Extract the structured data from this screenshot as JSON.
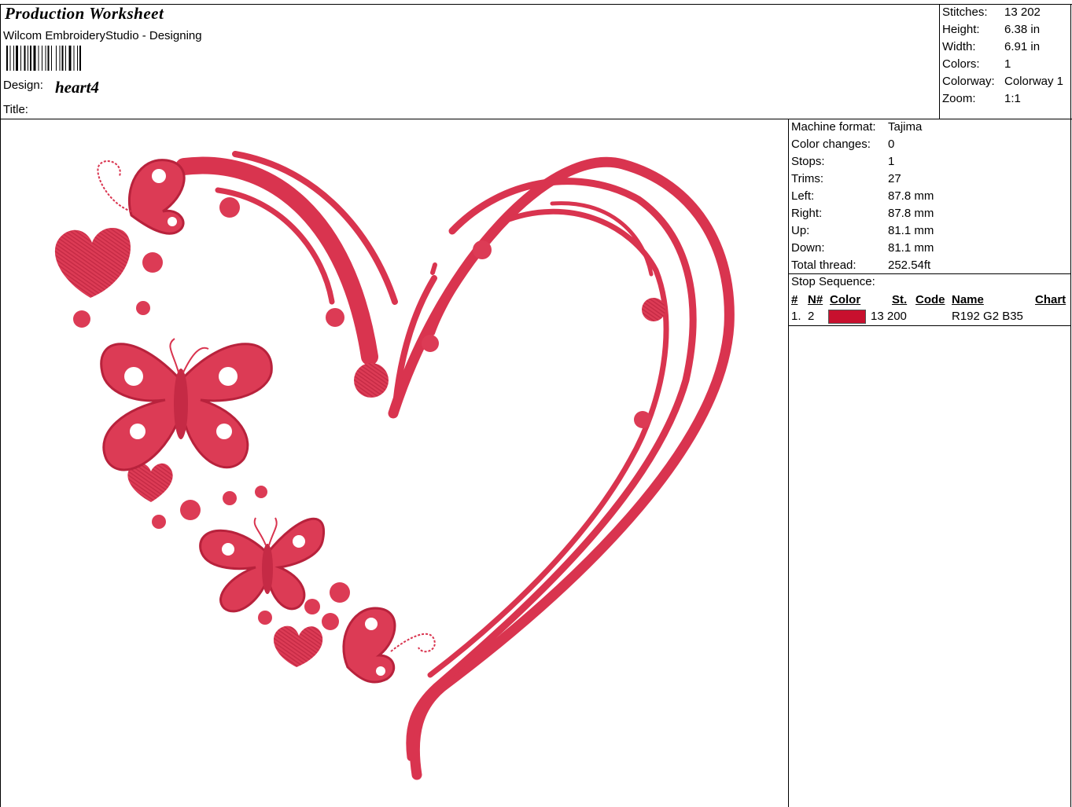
{
  "header": {
    "title": "Production Worksheet",
    "app": "Wilcom EmbroideryStudio - Designing",
    "design_label": "Design:",
    "design_value": "heart4",
    "title_label": "Title:"
  },
  "summary": [
    {
      "label": "Stitches:",
      "value": "13 202"
    },
    {
      "label": "Height:",
      "value": "6.38 in"
    },
    {
      "label": "Width:",
      "value": "6.91 in"
    },
    {
      "label": "Colors:",
      "value": "1"
    },
    {
      "label": "Colorway:",
      "value": "Colorway 1"
    },
    {
      "label": "Zoom:",
      "value": "1:1"
    }
  ],
  "machine_info": [
    {
      "label": "Machine format:",
      "value": "Tajima"
    },
    {
      "label": "Color changes:",
      "value": "0"
    },
    {
      "label": "Stops:",
      "value": "1"
    },
    {
      "label": "Trims:",
      "value": "27"
    },
    {
      "label": "Left:",
      "value": "87.8 mm"
    },
    {
      "label": "Right:",
      "value": "87.8 mm"
    },
    {
      "label": "Up:",
      "value": "81.1 mm"
    },
    {
      "label": "Down:",
      "value": "81.1 mm"
    },
    {
      "label": "Total thread:",
      "value": "252.54ft"
    }
  ],
  "stop_sequence": {
    "title": "Stop Sequence:",
    "headers": {
      "num": "#",
      "n": "N#",
      "color": "Color",
      "st": "St.",
      "code": "Code",
      "name": "Name",
      "chart": "Chart"
    },
    "rows": [
      {
        "num": "1.",
        "n": "2",
        "color": "#c8102e",
        "st": "13 200",
        "code": "",
        "name": "R192 G2 B35",
        "chart": ""
      }
    ]
  },
  "colors": {
    "thread": "#dc3b55",
    "thread_dark": "#b8223c",
    "swatch": "#c8102e"
  }
}
